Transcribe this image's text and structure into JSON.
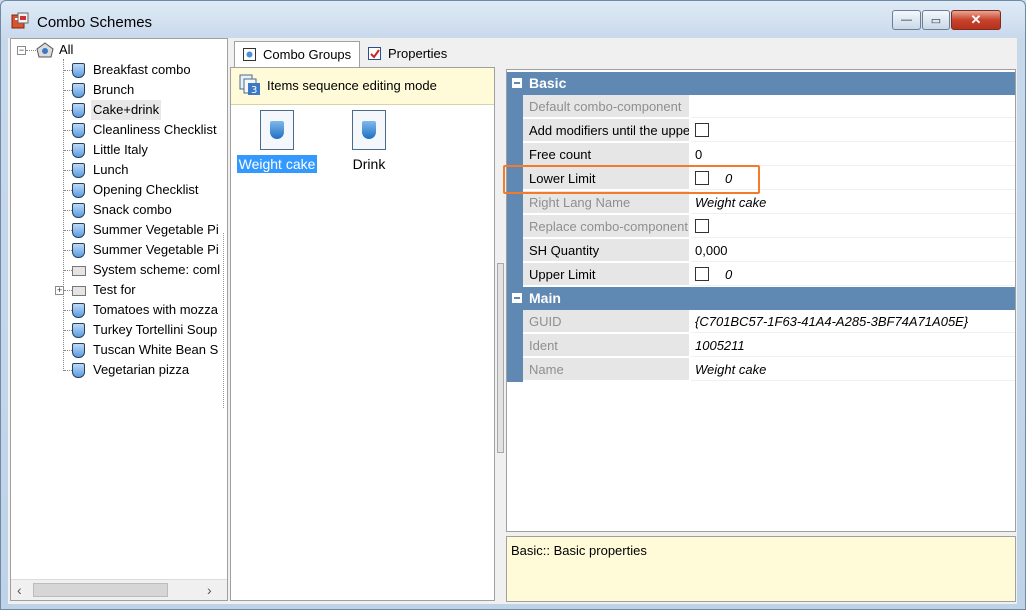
{
  "window": {
    "title": "Combo Schemes",
    "buttons": {
      "minimize": "—",
      "maximize": "▭",
      "close": "✕"
    }
  },
  "tree": {
    "root": "All",
    "items": [
      "Breakfast combo",
      "Brunch",
      "Cake+drink",
      "Cleanliness Checklist",
      "Little Italy",
      "Lunch",
      "Opening Checklist",
      "Snack combo",
      "Summer Vegetable Pi",
      "Summer Vegetable Pi",
      "System scheme: coml",
      "Test for",
      "Tomatoes with mozza",
      "Turkey Tortellini Soup",
      "Tuscan White Bean S",
      "Vegetarian pizza"
    ],
    "selected": "Cake+drink",
    "scroll_left": "‹",
    "scroll_right": "›"
  },
  "tabs": [
    {
      "label": "Combo Groups",
      "active": true
    },
    {
      "label": "Properties",
      "active": false
    }
  ],
  "mode_bar": {
    "text": "Items sequence editing mode",
    "icon_number": "3"
  },
  "groups": [
    {
      "label": "Weight cake",
      "selected": true
    },
    {
      "label": "Drink",
      "selected": false
    }
  ],
  "properties": {
    "categories": [
      {
        "name": "Basic",
        "rows": [
          {
            "name": "Default combo-component",
            "value": "",
            "readonly": true,
            "checkbox": false,
            "italic": false
          },
          {
            "name": "Add modifiers until the upper",
            "value": "",
            "readonly": false,
            "checkbox": true,
            "italic": false
          },
          {
            "name": "Free count",
            "value": "0",
            "readonly": false,
            "checkbox": false,
            "italic": false
          },
          {
            "name": "Lower Limit",
            "value": "0",
            "readonly": false,
            "checkbox": true,
            "italic": true
          },
          {
            "name": "Right Lang Name",
            "value": "Weight cake",
            "readonly": true,
            "checkbox": false,
            "italic": true
          },
          {
            "name": "Replace combo-component",
            "value": "",
            "readonly": true,
            "checkbox": true,
            "italic": false
          },
          {
            "name": "SH Quantity",
            "value": "0,000",
            "readonly": false,
            "checkbox": false,
            "italic": false
          },
          {
            "name": "Upper Limit",
            "value": "0",
            "readonly": false,
            "checkbox": true,
            "italic": true
          }
        ]
      },
      {
        "name": "Main",
        "rows": [
          {
            "name": "GUID",
            "value": "{C701BC57-1F63-41A4-A285-3BF74A71A05E}",
            "readonly": true,
            "checkbox": false,
            "italic": true
          },
          {
            "name": "Ident",
            "value": "1005211",
            "readonly": true,
            "checkbox": false,
            "italic": true
          },
          {
            "name": "Name",
            "value": "Weight cake",
            "readonly": true,
            "checkbox": false,
            "italic": true
          }
        ]
      }
    ]
  },
  "description": {
    "text": "Basic:: Basic properties"
  },
  "colors": {
    "category_header": "#5f88b3",
    "highlight": "#f47b2c",
    "selection": "#3399ff",
    "info_background": "#fffbd9"
  }
}
